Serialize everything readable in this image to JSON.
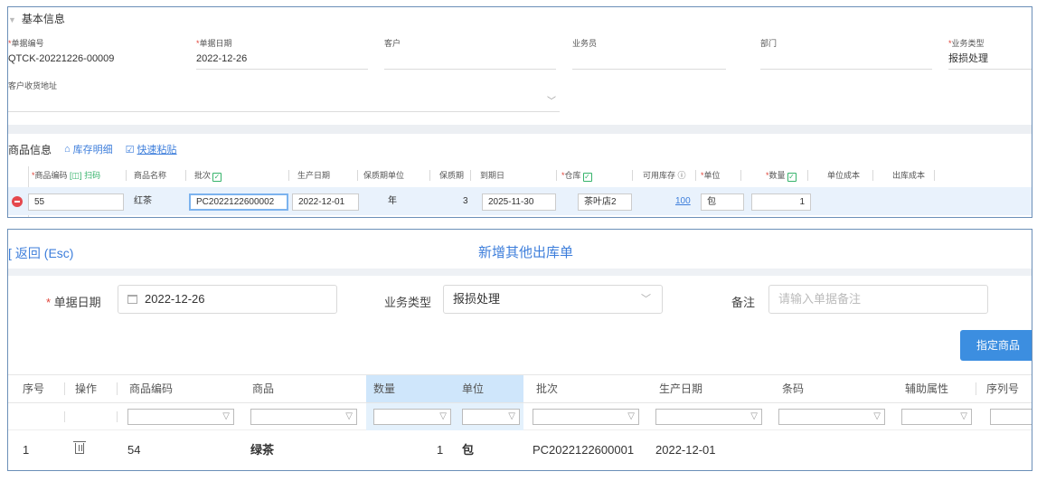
{
  "top": {
    "section_title": "基本信息",
    "fields": {
      "doc_no": {
        "label": "单据编号",
        "value": "QTCK-20221226-00009"
      },
      "doc_date": {
        "label": "单据日期",
        "value": "2022-12-26"
      },
      "customer": {
        "label": "客户",
        "value": ""
      },
      "salesman": {
        "label": "业务员",
        "value": ""
      },
      "dept": {
        "label": "部门",
        "value": ""
      },
      "biz_type": {
        "label": "业务类型",
        "value": "报损处理"
      },
      "address": {
        "label": "客户收货地址",
        "value": ""
      }
    },
    "goods_title": "商品信息",
    "links": {
      "stock_detail": "库存明细",
      "quick_paste": "快速粘贴"
    },
    "grid_headers": {
      "code": "商品编码",
      "scan": "扫码",
      "name": "商品名称",
      "batch": "批次",
      "prod_date": "生产日期",
      "shelf_unit": "保质期单位",
      "shelf": "保质期",
      "expire": "到期日",
      "warehouse": "仓库",
      "avail": "可用库存",
      "unit": "单位",
      "qty": "数量",
      "unit_cost": "单位成本",
      "out_cost": "出库成本"
    },
    "row": {
      "code": "55",
      "name": "红茶",
      "batch": "PC2022122600002",
      "prod_date": "2022-12-01",
      "shelf_unit": "年",
      "shelf": "3",
      "expire": "2025-11-30",
      "warehouse": "茶叶店2",
      "avail": "100",
      "unit": "包",
      "qty": "1"
    }
  },
  "bottom": {
    "back_label": "返回 (Esc)",
    "page_title": "新增其他出库单",
    "date_label": "单据日期",
    "date_value": "2022-12-26",
    "biz_label": "业务类型",
    "biz_value": "报损处理",
    "remark_label": "备注",
    "remark_placeholder": "请输入单据备注",
    "assign_button": "指定商品",
    "columns": {
      "seq": "序号",
      "op": "操作",
      "code": "商品编码",
      "goods": "商品",
      "qty": "数量",
      "unit": "单位",
      "batch": "批次",
      "prod_date": "生产日期",
      "barcode": "条码",
      "aux": "辅助属性",
      "serial": "序列号"
    },
    "row": {
      "seq": "1",
      "code": "54",
      "goods": "绿茶",
      "qty": "1",
      "unit": "包",
      "batch": "PC2022122600001",
      "prod_date": "2022-12-01"
    }
  },
  "colors": {
    "accent": "#3d7edb",
    "primary_button": "#3c8ee0",
    "required": "#e0453a",
    "check": "#36b36b"
  }
}
